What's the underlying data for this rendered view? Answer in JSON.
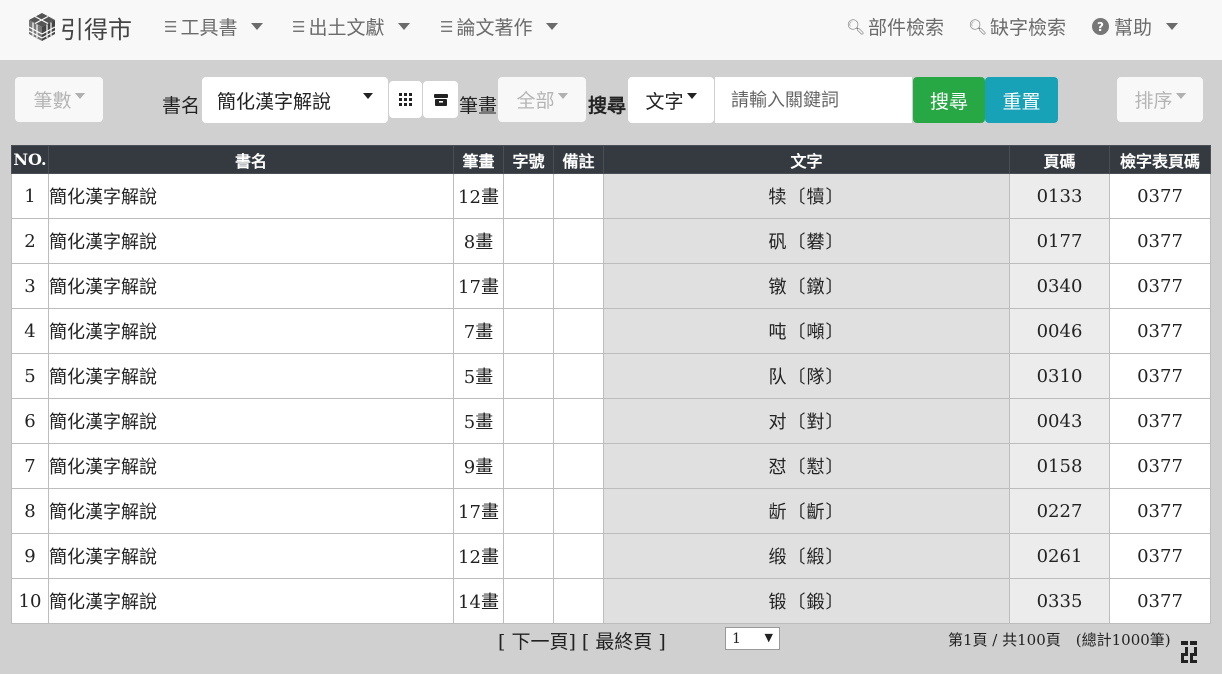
{
  "brand": {
    "name": "引得市",
    "logo_icon": "cube-logo-icon"
  },
  "nav": {
    "left": [
      {
        "label": "工具書",
        "icon": "list-icon"
      },
      {
        "label": "出土文獻",
        "icon": "list-icon"
      },
      {
        "label": "論文著作",
        "icon": "list-icon"
      }
    ],
    "right": {
      "component_search": "部件檢索",
      "missing_char_search": "缺字檢索",
      "help": "幫助"
    }
  },
  "toolbar": {
    "stroke_count_button": "筆數",
    "book_label": "書名",
    "book_value": "簡化漢字解說",
    "stroke_label": "筆畫",
    "stroke_value": "全部",
    "search_label": "搜尋",
    "search_type": "文字",
    "search_placeholder": "請輸入關鍵詞",
    "search_button": "搜尋",
    "reset_button": "重置",
    "sort_button": "排序"
  },
  "table": {
    "headers": [
      "NO.",
      "書名",
      "筆畫",
      "字號",
      "備註",
      "文字",
      "頁碼",
      "檢字表頁碼"
    ],
    "rows": [
      {
        "no": "1",
        "book": "簡化漢字解說",
        "stroke": "12畫",
        "num": "",
        "note": "",
        "char": "犊〔犢〕",
        "page": "0133",
        "index_page": "0377"
      },
      {
        "no": "2",
        "book": "簡化漢字解說",
        "stroke": "8畫",
        "num": "",
        "note": "",
        "char": "矾〔礬〕",
        "page": "0177",
        "index_page": "0377"
      },
      {
        "no": "3",
        "book": "簡化漢字解說",
        "stroke": "17畫",
        "num": "",
        "note": "",
        "char": "镦〔鐓〕",
        "page": "0340",
        "index_page": "0377"
      },
      {
        "no": "4",
        "book": "簡化漢字解說",
        "stroke": "7畫",
        "num": "",
        "note": "",
        "char": "吨〔噸〕",
        "page": "0046",
        "index_page": "0377"
      },
      {
        "no": "5",
        "book": "簡化漢字解說",
        "stroke": "5畫",
        "num": "",
        "note": "",
        "char": "队〔隊〕",
        "page": "0310",
        "index_page": "0377"
      },
      {
        "no": "6",
        "book": "簡化漢字解說",
        "stroke": "5畫",
        "num": "",
        "note": "",
        "char": "对〔對〕",
        "page": "0043",
        "index_page": "0377"
      },
      {
        "no": "7",
        "book": "簡化漢字解說",
        "stroke": "9畫",
        "num": "",
        "note": "",
        "char": "怼〔懟〕",
        "page": "0158",
        "index_page": "0377"
      },
      {
        "no": "8",
        "book": "簡化漢字解說",
        "stroke": "17畫",
        "num": "",
        "note": "",
        "char": "龂〔齗〕",
        "page": "0227",
        "index_page": "0377"
      },
      {
        "no": "9",
        "book": "簡化漢字解說",
        "stroke": "12畫",
        "num": "",
        "note": "",
        "char": "缎〔緞〕",
        "page": "0261",
        "index_page": "0377"
      },
      {
        "no": "10",
        "book": "簡化漢字解說",
        "stroke": "14畫",
        "num": "",
        "note": "",
        "char": "锻〔鍛〕",
        "page": "0335",
        "index_page": "0377"
      }
    ]
  },
  "pager": {
    "next": "[ 下一頁]",
    "last": "[ 最終頁 ]",
    "current_page": "1",
    "info": "第1頁 / 共100頁　(總計1000筆)"
  },
  "colors": {
    "nav_bg": "#f8f8f8",
    "page_bg": "#d0d0d0",
    "table_header_bg": "#343a40",
    "search_green": "#28a745",
    "reset_teal": "#17a2b8"
  }
}
